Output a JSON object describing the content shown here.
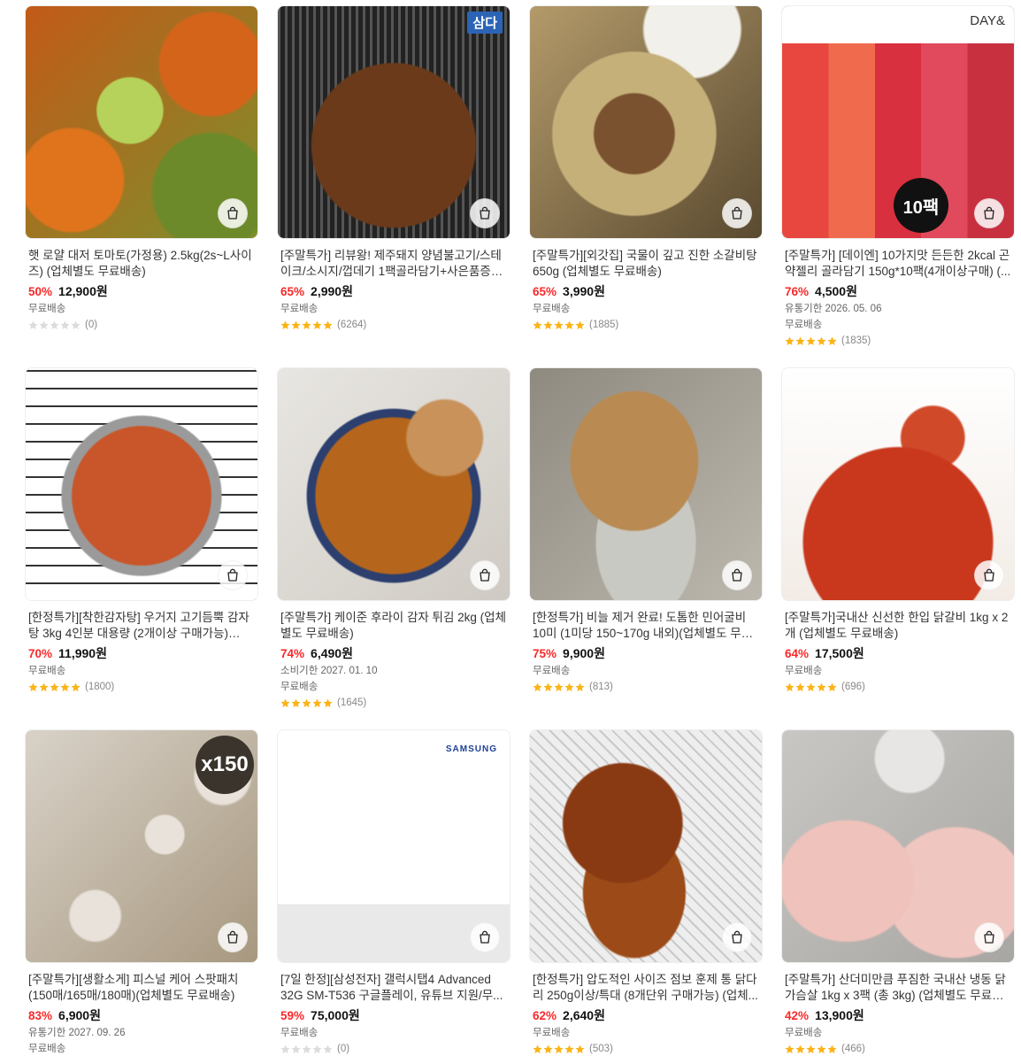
{
  "products": [
    {
      "title": "햇 로얄 대저 토마토(가정용) 2.5kg(2s~L사이즈) (업체별도 무료배송)",
      "discount": "50%",
      "price": "12,900원",
      "extra": "",
      "shipping": "무료배송",
      "stars": 0,
      "reviews": "(0)",
      "image": "tomato-photo",
      "overlay": ""
    },
    {
      "title": "[주말특가] 리뷰왕! 제주돼지 양념불고기/스테이크/소시지/껍데기 1팩골라담기+사은품증정...",
      "discount": "65%",
      "price": "2,990원",
      "extra": "",
      "shipping": "무료배송",
      "stars": 5,
      "reviews": "(6264)",
      "image": "pork-bulgogi-photo",
      "overlay": "삼다"
    },
    {
      "title": "[주말특가][외갓집] 국물이 깊고 진한 소갈비탕 650g (업체별도 무료배송)",
      "discount": "65%",
      "price": "3,990원",
      "extra": "",
      "shipping": "무료배송",
      "stars": 5,
      "reviews": "(1885)",
      "image": "galbitang-photo",
      "overlay": ""
    },
    {
      "title": "[주말특가] [데이엔] 10가지맛 든든한 2kcal 곤약젤리 골라담기 150g*10팩(4개이상구매) (...",
      "discount": "76%",
      "price": "4,500원",
      "extra": "유통기한 2026. 05. 06",
      "shipping": "무료배송",
      "stars": 5,
      "reviews": "(1835)",
      "image": "konjac-jelly-photo",
      "overlay": "DAY&",
      "overlay2": "10팩"
    },
    {
      "title": "[한정특가][착한감자탕] 우거지 고기듬뿍 감자탕 3kg 4인분 대용량 (2개이상 구매가능) (업...",
      "discount": "70%",
      "price": "11,990원",
      "extra": "",
      "shipping": "무료배송",
      "stars": 5,
      "reviews": "(1800)",
      "image": "gamjatang-photo",
      "overlay": ""
    },
    {
      "title": "[주말특가] 케이준 후라이 감자 튀김 2kg (업체별도 무료배송)",
      "discount": "74%",
      "price": "6,490원",
      "extra": "소비기한 2027. 01. 10",
      "shipping": "무료배송",
      "stars": 5,
      "reviews": "(1645)",
      "image": "fries-photo",
      "overlay": ""
    },
    {
      "title": "[한정특가] 비늘 제거 완료! 도톰한 민어굴비 10미 (1미당 150~170g 내외)(업체별도 무료배...",
      "discount": "75%",
      "price": "9,900원",
      "extra": "",
      "shipping": "무료배송",
      "stars": 4.5,
      "reviews": "(813)",
      "image": "fish-photo",
      "overlay": ""
    },
    {
      "title": "[주말특가]국내산 신선한 한입 닭갈비 1kg x 2개 (업체별도 무료배송)",
      "discount": "64%",
      "price": "17,500원",
      "extra": "",
      "shipping": "무료배송",
      "stars": 5,
      "reviews": "(696)",
      "image": "dakgalbi-photo",
      "overlay": ""
    },
    {
      "title": "[주말특가][생활소게] 피스널 케어 스팟패치 (150매/165매/180매)(업체별도 무료배송)",
      "discount": "83%",
      "price": "6,900원",
      "extra": "유통기한 2027. 09. 26",
      "shipping": "무료배송",
      "stars": 0,
      "reviews": "",
      "image": "spot-patch-photo",
      "overlay": "x150"
    },
    {
      "title": "[7일 한정][삼성전자] 갤럭시탭4 Advanced 32G SM-T536 구글플레이, 유튜브 지원/무...",
      "discount": "59%",
      "price": "75,000원",
      "extra": "",
      "shipping": "무료배송",
      "stars": 0,
      "reviews": "(0)",
      "image": "galaxy-tab-photo",
      "overlay": "SAMSUNG"
    },
    {
      "title": "[한정특가] 압도적인 사이즈 점보 훈제 통 닭다리 250g이상/특대 (8개단위 구매가능) (업체...",
      "discount": "62%",
      "price": "2,640원",
      "extra": "",
      "shipping": "무료배송",
      "stars": 5,
      "reviews": "(503)",
      "image": "smoked-chicken-leg-photo",
      "overlay": ""
    },
    {
      "title": "[주말특가] 산더미만큼 푸짐한 국내산 냉동 닭가슴살 1kg x 3팩 (총 3kg) (업체별도 무료배송)",
      "discount": "42%",
      "price": "13,900원",
      "extra": "",
      "shipping": "무료배송",
      "stars": 5,
      "reviews": "(466)",
      "image": "chicken-breast-photo",
      "overlay": ""
    }
  ]
}
